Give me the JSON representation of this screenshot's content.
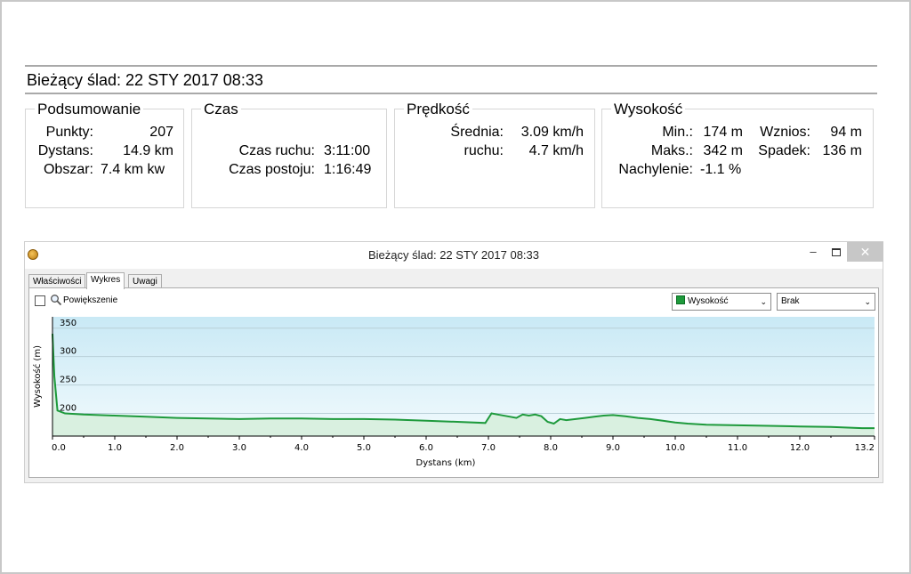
{
  "summary": {
    "title": "Bieżący ślad: 22 STY 2017 08:33",
    "podsumowanie": {
      "legend": "Podsumowanie",
      "punkty_label": "Punkty:",
      "punkty_value": "207",
      "dystans_label": "Dystans:",
      "dystans_value": "14.9 km",
      "obszar_label": "Obszar:",
      "obszar_value": "7.4 km kw"
    },
    "czas": {
      "legend": "Czas",
      "ruch_label": "Czas ruchu:",
      "ruch_value": "3:11:00",
      "postoj_label": "Czas postoju:",
      "postoj_value": "1:16:49"
    },
    "predkosc": {
      "legend": "Prędkość",
      "srednia_label": "Średnia:",
      "srednia_value": "3.09 km/h",
      "ruchu_label": "ruchu:",
      "ruchu_value": "4.7 km/h"
    },
    "wysokosc": {
      "legend": "Wysokość",
      "min_label": "Min.:",
      "min_value": "174 m",
      "maks_label": "Maks.:",
      "maks_value": "342 m",
      "nachylenie_label": "Nachylenie:",
      "nachylenie_value": "-1.1 %",
      "wznios_label": "Wznios:",
      "wznios_value": "94 m",
      "spadek_label": "Spadek:",
      "spadek_value": "136 m"
    }
  },
  "window": {
    "title": "Bieżący ślad: 22 STY 2017 08:33",
    "minimize_glyph": "–",
    "close_glyph": "✕",
    "tabs": [
      "Właściwości",
      "Wykres",
      "Uwagi"
    ],
    "active_tab": 1,
    "zoom_label": "Powiększenie",
    "series_select": "Wysokość",
    "secondary_select": "Brak",
    "colors": {
      "line": "#1e9a3c",
      "fill": "#d9f0e0",
      "plot_bg_top": "#c9e9f5",
      "plot_bg_bottom": "#f1fafd"
    }
  },
  "chart_data": {
    "type": "area",
    "xlabel": "Dystans (km)",
    "ylabel": "Wysokość (m)",
    "xlim": [
      0,
      13.2
    ],
    "ylim": [
      160,
      370
    ],
    "x_ticks": [
      "0.0",
      "1.0",
      "2.0",
      "3.0",
      "4.0",
      "5.0",
      "6.0",
      "7.0",
      "8.0",
      "9.0",
      "10.0",
      "11.0",
      "12.0",
      "13.2"
    ],
    "x_tick_values": [
      0,
      1,
      2,
      3,
      4,
      5,
      6,
      7,
      8,
      9,
      10,
      11,
      12,
      13.2
    ],
    "y_ticks": [
      "200",
      "250",
      "300",
      "350"
    ],
    "y_tick_values": [
      200,
      250,
      300,
      350
    ],
    "grid": true,
    "series": [
      {
        "x": [
          0,
          0.03,
          0.08,
          0.2,
          0.5,
          1.0,
          1.5,
          2.0,
          2.5,
          3.0,
          3.5,
          4.0,
          4.5,
          5.0,
          5.5,
          6.0,
          6.5,
          6.95,
          7.05,
          7.15,
          7.3,
          7.45,
          7.55,
          7.65,
          7.75,
          7.85,
          7.95,
          8.05,
          8.15,
          8.25,
          8.4,
          8.55,
          8.7,
          8.85,
          9.0,
          9.2,
          9.4,
          9.6,
          9.8,
          10.0,
          10.2,
          10.5,
          11.0,
          11.5,
          12.0,
          12.5,
          13.0,
          13.2
        ],
        "y": [
          340,
          265,
          205,
          200,
          198,
          196,
          194,
          192,
          191,
          190,
          191,
          191,
          190,
          190,
          189,
          187,
          185,
          183,
          200,
          198,
          195,
          192,
          198,
          196,
          198,
          195,
          185,
          182,
          190,
          188,
          190,
          192,
          194,
          196,
          197,
          195,
          192,
          190,
          187,
          184,
          182,
          180,
          179,
          178,
          177,
          176,
          174,
          174
        ]
      }
    ]
  }
}
